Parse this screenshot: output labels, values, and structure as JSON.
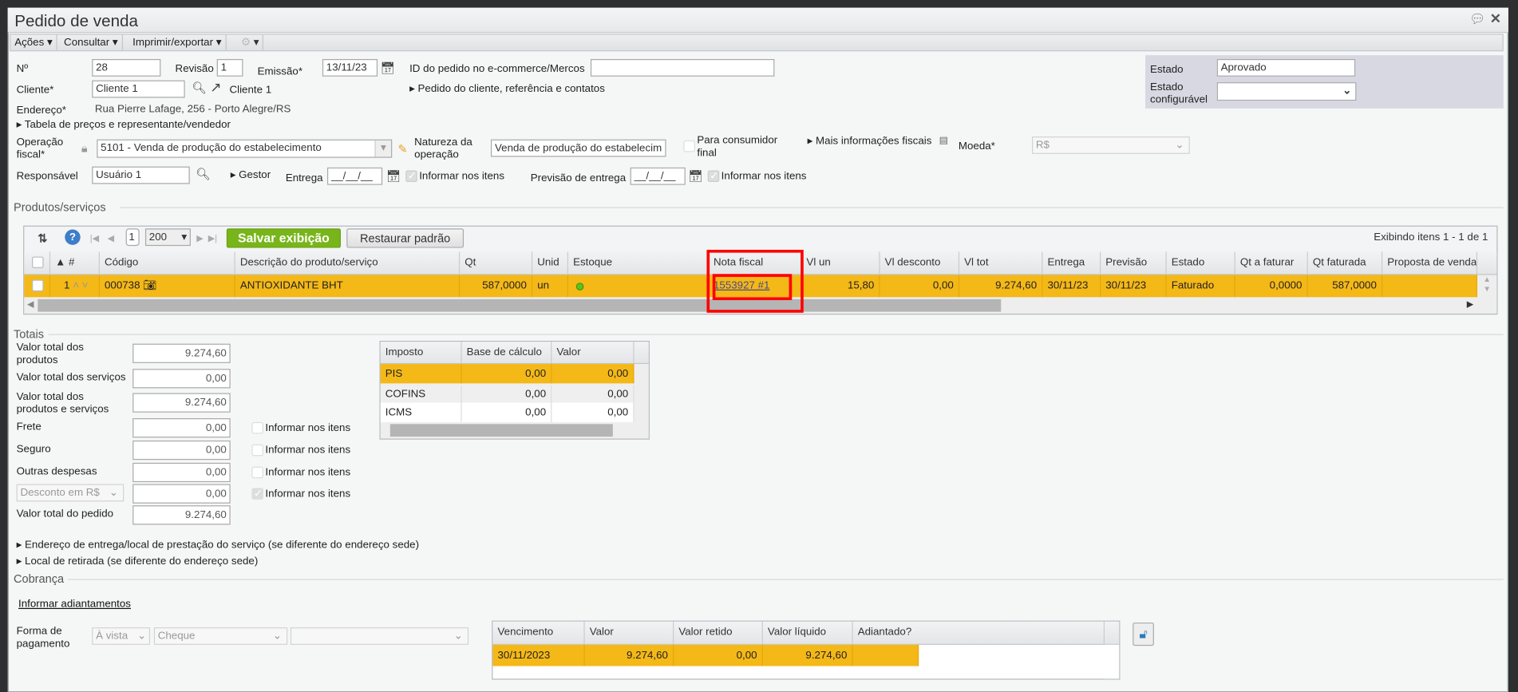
{
  "window": {
    "title": "Pedido de venda",
    "chat_icon": "chat-icon",
    "close_icon": "close-icon"
  },
  "toolbar": {
    "acoes": "Ações",
    "consultar": "Consultar",
    "imprimir": "Imprimir/exportar"
  },
  "form": {
    "numero_label": "Nº",
    "numero": "28",
    "revisao_label": "Revisão",
    "revisao": "1",
    "emissao_label": "Emissão*",
    "emissao": "13/11/23",
    "id_ecommerce_label": "ID do pedido no e-commerce/Mercos",
    "id_ecommerce": "",
    "cliente_label": "Cliente*",
    "cliente": "Cliente 1",
    "cliente_link": "Cliente 1",
    "pedido_cliente_link": "Pedido do cliente, referência e contatos",
    "endereco_label": "Endereço*",
    "endereco": "Rua Pierre Lafage, 256 - Porto Alegre/RS",
    "tabela_precos_link": "Tabela de preços e representante/vendedor",
    "operacao_label_1": "Operação",
    "operacao_label_2": "fiscal*",
    "operacao": "5101 - Venda de produção do estabelecimento",
    "natureza_label_1": "Natureza da",
    "natureza_label_2": "operação",
    "natureza": "Venda de produção do estabelecimento",
    "consumidor_label_1": "Para consumidor",
    "consumidor_label_2": "final",
    "mais_info_link": "Mais informações fiscais",
    "moeda_label": "Moeda*",
    "moeda": "R$",
    "responsavel_label": "Responsável",
    "responsavel": "Usuário 1",
    "gestor_link": "Gestor",
    "entrega_label": "Entrega",
    "entrega": "__/__/__",
    "informar_itens": "Informar nos itens",
    "previsao_label": "Previsão de entrega",
    "previsao": "__/__/__"
  },
  "estado": {
    "label": "Estado",
    "value": "Aprovado",
    "config_label_1": "Estado",
    "config_label_2": "configurável",
    "config_value": ""
  },
  "produtos": {
    "section": "Produtos/serviços",
    "page": "1",
    "page_size": "200",
    "save_view": "Salvar exibição",
    "restore": "Restaurar padrão",
    "showing": "Exibindo itens 1 - 1 de 1",
    "columns": [
      "",
      "▲ #",
      "Código",
      "Descrição do produto/serviço",
      "Qt",
      "Unid",
      "Estoque",
      "Nota fiscal",
      "Vl un",
      "Vl desconto",
      "Vl tot",
      "Entrega",
      "Previsão",
      "Estado",
      "Qt a faturar",
      "Qt faturada",
      "Proposta de venda"
    ],
    "row": {
      "num": "1",
      "codigo": "000738",
      "descricao": "ANTIOXIDANTE BHT",
      "qt": "587,0000",
      "unid": "un",
      "nota_fiscal": "1553927 #1",
      "vl_un": "15,80",
      "vl_desconto": "0,00",
      "vl_tot": "9.274,60",
      "entrega": "30/11/23",
      "previsao": "30/11/23",
      "estado": "Faturado",
      "qt_a_faturar": "0,0000",
      "qt_faturada": "587,0000",
      "proposta": ""
    },
    "highlight_color": "#f4b817"
  },
  "totais": {
    "section": "Totais",
    "rows": [
      {
        "label": "Valor total dos produtos",
        "value": "9.274,60"
      },
      {
        "label": "Valor total dos serviços",
        "value": "0,00"
      },
      {
        "label": "Valor total dos produtos e serviços",
        "value": "9.274,60"
      },
      {
        "label": "Frete",
        "value": "0,00"
      },
      {
        "label": "Seguro",
        "value": "0,00"
      },
      {
        "label": "Outras despesas",
        "value": "0,00"
      },
      {
        "label": "Desconto em R$",
        "value": "0,00"
      },
      {
        "label": "Valor total do pedido",
        "value": "9.274,60"
      }
    ],
    "informar_itens": "Informar nos itens",
    "impostos": {
      "columns": [
        "Imposto",
        "Base de cálculo",
        "Valor"
      ],
      "rows": [
        [
          "PIS",
          "0,00",
          "0,00"
        ],
        [
          "COFINS",
          "0,00",
          "0,00"
        ],
        [
          "ICMS",
          "0,00",
          "0,00"
        ]
      ]
    }
  },
  "links": {
    "endereco_entrega": "Endereço de entrega/local de prestação do serviço (se diferente do endereço sede)",
    "local_retirada": "Local de retirada (se diferente do endereço sede)"
  },
  "cobranca": {
    "section": "Cobrança",
    "adiantamentos": "Informar adiantamentos",
    "forma_label_1": "Forma de",
    "forma_label_2": "pagamento",
    "prazo": "À vista",
    "meio": "Cheque",
    "extra": "",
    "columns": [
      "Vencimento",
      "Valor",
      "Valor retido",
      "Valor líquido",
      "Adiantado?"
    ],
    "row": [
      "30/11/2023",
      "9.274,60",
      "0,00",
      "9.274,60",
      ""
    ]
  }
}
